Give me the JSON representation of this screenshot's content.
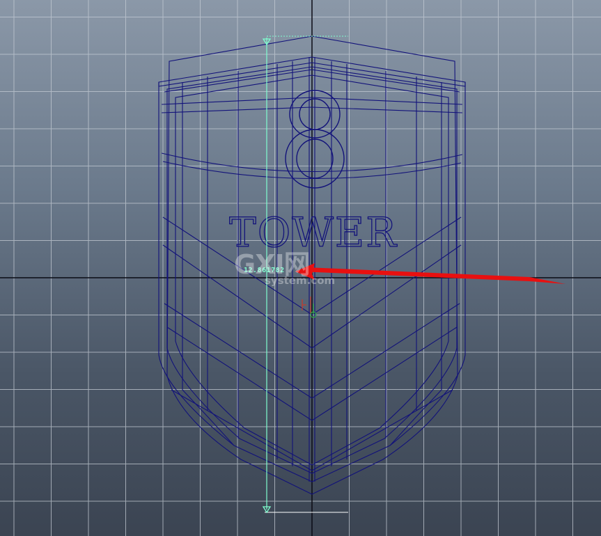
{
  "viewport": {
    "measure_value": "12.861782",
    "model_text": {
      "number": "8",
      "word": "TOWER"
    },
    "watermark": {
      "main": "GXI网",
      "sub": "system.com"
    }
  },
  "colors": {
    "background_top": "#8b98a8",
    "background_bottom": "#3b4452",
    "grid": "#c4cbd4",
    "axis": "#0a0a14",
    "wireframe": "#12127a",
    "measure": "#7fffd0",
    "arrow": "#e81010"
  },
  "icons": [
    "measure-start-locator-icon",
    "measure-end-locator-icon",
    "pivot-manipulator-icon",
    "annotation-arrow-icon"
  ]
}
